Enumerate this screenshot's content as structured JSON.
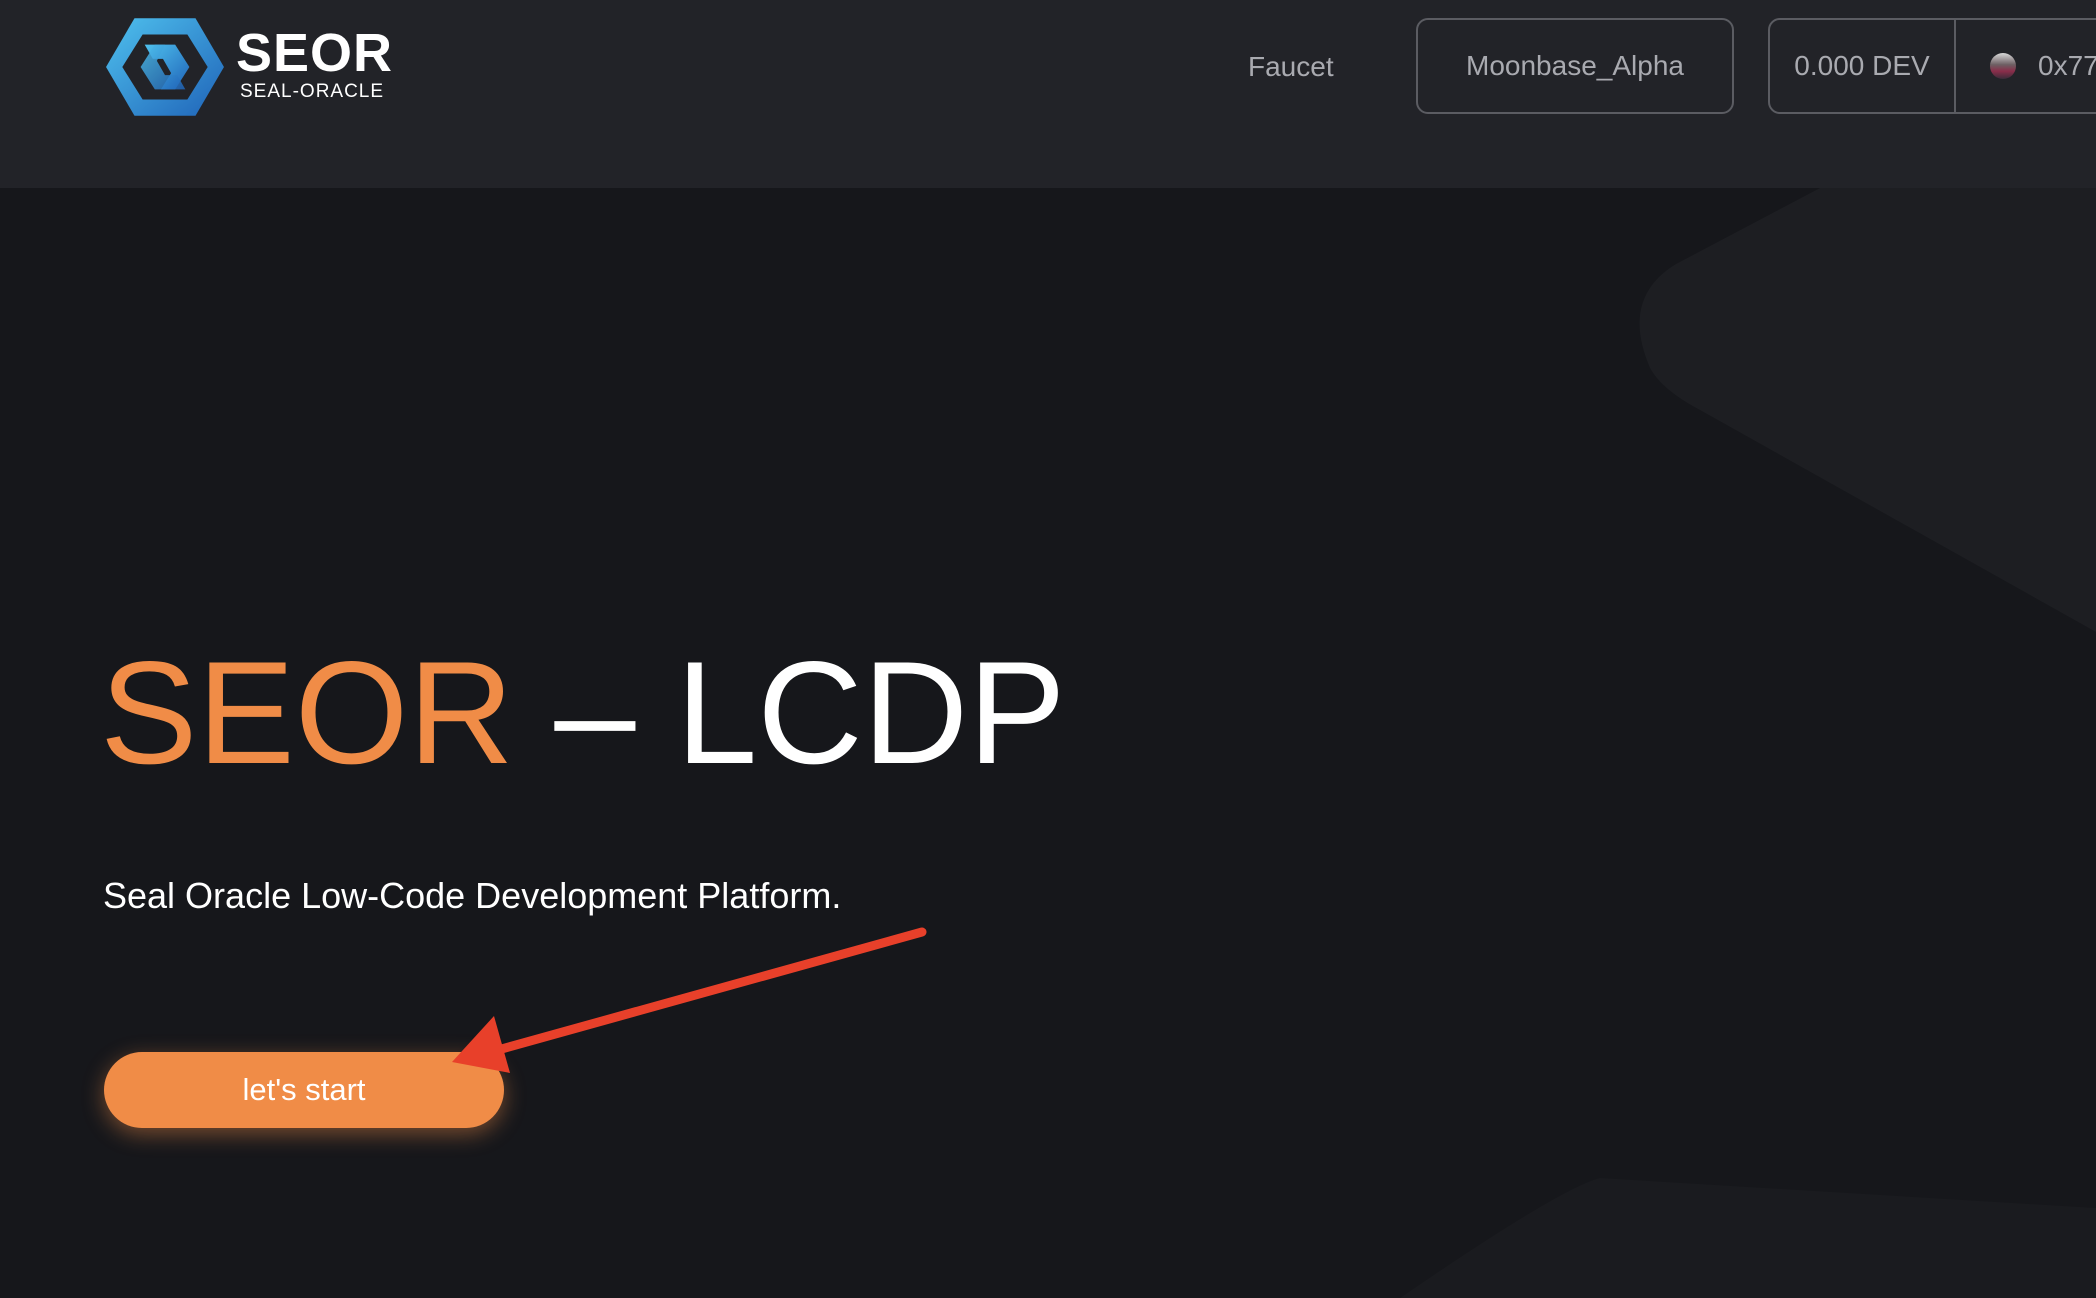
{
  "header": {
    "brand_name": "SEOR",
    "brand_subtitle": "SEAL-ORACLE",
    "nav_faucet": "Faucet",
    "network_label": "Moonbase_Alpha",
    "balance_label": "0.000 DEV",
    "account_label": "0x77"
  },
  "hero": {
    "title_accent": "SEOR",
    "title_rest": " – LCDP",
    "subtitle": "Seal Oracle Low-Code Development Platform.",
    "cta_label": "let's start"
  },
  "colors": {
    "accent": "#f08c47",
    "header_bg": "#222328",
    "page_bg": "#16171b",
    "annotation_arrow": "#e8402a"
  },
  "icons": {
    "logo": "seor-hexagon-logo",
    "avatar": "account-avatar",
    "annotation": "red-arrow-annotation"
  }
}
